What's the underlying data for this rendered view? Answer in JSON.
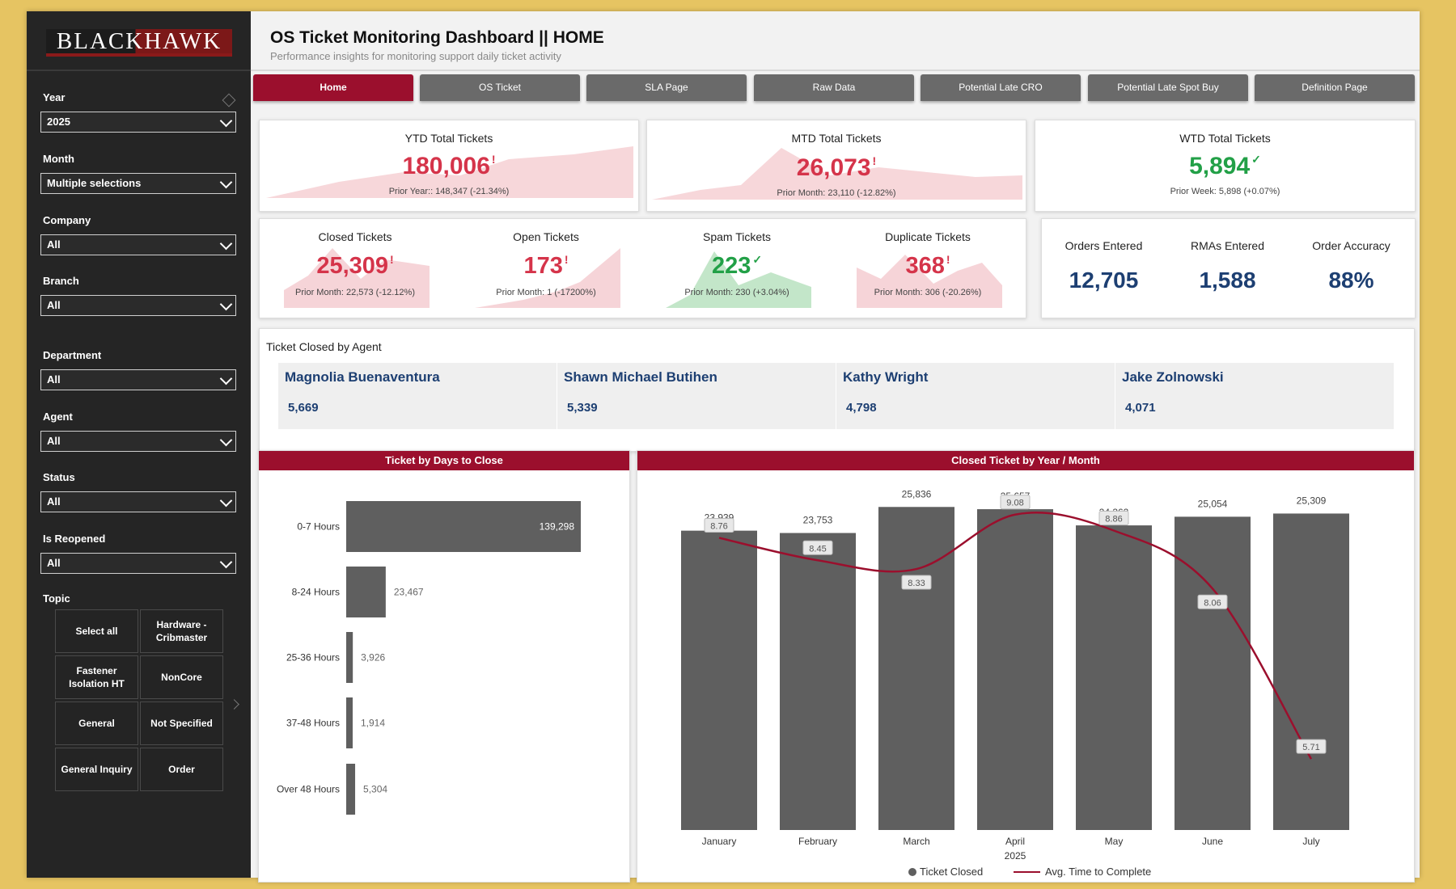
{
  "brand": {
    "logo": "BLACKHAWK"
  },
  "header": {
    "title": "OS Ticket Monitoring Dashboard || HOME",
    "subtitle": "Performance insights for monitoring support daily ticket activity"
  },
  "filters": {
    "year": {
      "label": "Year",
      "value": "2025"
    },
    "month": {
      "label": "Month",
      "value": "Multiple selections"
    },
    "company": {
      "label": "Company",
      "value": "All"
    },
    "branch": {
      "label": "Branch",
      "value": "All"
    },
    "department": {
      "label": "Department",
      "value": "All"
    },
    "agent": {
      "label": "Agent",
      "value": "All"
    },
    "status": {
      "label": "Status",
      "value": "All"
    },
    "reopened": {
      "label": "Is Reopened",
      "value": "All"
    },
    "topic": {
      "label": "Topic",
      "options": [
        "Select all",
        "Hardware - Cribmaster",
        "Fastener Isolation HT",
        "NonCore",
        "General",
        "Not Specified",
        "General Inquiry",
        "Order"
      ]
    }
  },
  "tabs": [
    "Home",
    "OS Ticket",
    "SLA Page",
    "Raw Data",
    "Potential Late CRO",
    "Potential Late Spot Buy",
    "Definition Page"
  ],
  "kpis": {
    "ytd": {
      "title": "YTD Total Tickets",
      "value": "180,006",
      "mark": "!",
      "sub": "Prior Year:: 148,347 (-21.34%)"
    },
    "mtd": {
      "title": "MTD Total Tickets",
      "value": "26,073",
      "mark": "!",
      "sub": "Prior Month: 23,110 (-12.82%)"
    },
    "wtd": {
      "title": "WTD Total Tickets",
      "value": "5,894",
      "mark": "✓",
      "sub": "Prior Week: 5,898 (+0.07%)"
    },
    "closed": {
      "title": "Closed Tickets",
      "value": "25,309",
      "mark": "!",
      "sub": "Prior Month: 22,573 (-12.12%)"
    },
    "open": {
      "title": "Open Tickets",
      "value": "173",
      "mark": "!",
      "sub": "Prior Month: 1 (-17200%)"
    },
    "spam": {
      "title": "Spam Tickets",
      "value": "223",
      "mark": "✓",
      "sub": "Prior Month: 230 (+3.04%)"
    },
    "duplicate": {
      "title": "Duplicate Tickets",
      "value": "368",
      "mark": "!",
      "sub": "Prior Month: 306 (-20.26%)"
    },
    "orders": {
      "title": "Orders Entered",
      "value": "12,705"
    },
    "rmas": {
      "title": "RMAs Entered",
      "value": "1,588"
    },
    "accuracy": {
      "title": "Order Accuracy",
      "value": "88%"
    }
  },
  "agents": {
    "title": "Ticket Closed by Agent",
    "items": [
      {
        "name": "Magnolia Buenaventura",
        "value": "5,669"
      },
      {
        "name": "Shawn Michael Butihen",
        "value": "5,339"
      },
      {
        "name": "Kathy Wright",
        "value": "4,798"
      },
      {
        "name": "Jake Zolnowski",
        "value": "4,071"
      }
    ]
  },
  "chart_data": [
    {
      "type": "bar",
      "orientation": "horizontal",
      "title": "Ticket by Days to Close",
      "categories": [
        "0-7 Hours",
        "8-24 Hours",
        "25-36 Hours",
        "37-48 Hours",
        "Over 48 Hours"
      ],
      "values": [
        139298,
        23467,
        3926,
        1914,
        5304
      ],
      "labels": [
        "139,298",
        "23,467",
        "3,926",
        "1,914",
        "5,304"
      ],
      "bar_color": "#5f5f5f"
    },
    {
      "type": "bar",
      "title": "Closed Ticket by Year / Month",
      "categories": [
        "January",
        "February",
        "March",
        "April",
        "May",
        "June",
        "July"
      ],
      "year_label": "2025",
      "series": [
        {
          "name": "Ticket Closed",
          "type": "bar",
          "values": [
            23939,
            23753,
            25836,
            25657,
            24362,
            25054,
            25309
          ],
          "labels": [
            "23,939",
            "23,753",
            "25,836",
            "25,657",
            "24,362",
            "25,054",
            "25,309"
          ],
          "color": "#5f5f5f"
        },
        {
          "name": "Avg. Time to Complete",
          "type": "line",
          "values": [
            8.76,
            8.45,
            8.33,
            9.08,
            8.86,
            8.06,
            5.71
          ],
          "labels": [
            "8.76",
            "8.45",
            "8.33",
            "9.08",
            "8.86",
            "8.06",
            "5.71"
          ],
          "color": "#9b0f2d"
        }
      ]
    }
  ]
}
